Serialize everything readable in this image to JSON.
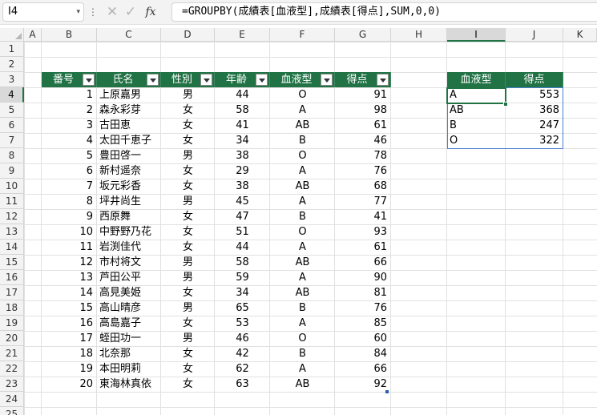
{
  "formula_bar": {
    "name_box": "I4",
    "formula": "=GROUPBY(成績表[血液型],成績表[得点],SUM,0,0)",
    "cancel_glyph": "✕",
    "enter_glyph": "✓",
    "fx_label": "fx"
  },
  "columns": [
    "A",
    "B",
    "C",
    "D",
    "E",
    "F",
    "G",
    "H",
    "I",
    "J",
    "K"
  ],
  "rows": [
    "1",
    "2",
    "3",
    "4",
    "5",
    "6",
    "7",
    "8",
    "9",
    "10",
    "11",
    "12",
    "13",
    "14",
    "15",
    "16",
    "17",
    "18",
    "19",
    "20",
    "21",
    "22",
    "23",
    "24",
    "25"
  ],
  "selected_column": "I",
  "selected_row": "4",
  "score_table": {
    "headers": [
      "番号",
      "氏名",
      "性別",
      "年齢",
      "血液型",
      "得点"
    ],
    "rows": [
      [
        "1",
        "上原嘉男",
        "男",
        "44",
        "O",
        "91"
      ],
      [
        "2",
        "森永彩芽",
        "女",
        "58",
        "A",
        "98"
      ],
      [
        "3",
        "古田恵",
        "女",
        "41",
        "AB",
        "61"
      ],
      [
        "4",
        "太田千恵子",
        "女",
        "34",
        "B",
        "46"
      ],
      [
        "5",
        "豊田啓一",
        "男",
        "38",
        "O",
        "78"
      ],
      [
        "6",
        "新村遥奈",
        "女",
        "29",
        "A",
        "76"
      ],
      [
        "7",
        "坂元彩香",
        "女",
        "38",
        "AB",
        "68"
      ],
      [
        "8",
        "坪井尚生",
        "男",
        "45",
        "A",
        "77"
      ],
      [
        "9",
        "西原舞",
        "女",
        "47",
        "B",
        "41"
      ],
      [
        "10",
        "中野野乃花",
        "女",
        "51",
        "O",
        "93"
      ],
      [
        "11",
        "岩渕佳代",
        "女",
        "44",
        "A",
        "61"
      ],
      [
        "12",
        "市村将文",
        "男",
        "58",
        "AB",
        "66"
      ],
      [
        "13",
        "芦田公平",
        "男",
        "59",
        "A",
        "90"
      ],
      [
        "14",
        "高見美姫",
        "女",
        "34",
        "AB",
        "81"
      ],
      [
        "15",
        "高山晴彦",
        "男",
        "65",
        "B",
        "76"
      ],
      [
        "16",
        "高島嘉子",
        "女",
        "53",
        "A",
        "85"
      ],
      [
        "17",
        "蛭田功一",
        "男",
        "46",
        "O",
        "60"
      ],
      [
        "18",
        "北奈那",
        "女",
        "42",
        "B",
        "84"
      ],
      [
        "19",
        "本田明莉",
        "女",
        "62",
        "A",
        "66"
      ],
      [
        "20",
        "東海林真依",
        "女",
        "63",
        "AB",
        "92"
      ]
    ]
  },
  "groupby_result": {
    "headers": [
      "血液型",
      "得点"
    ],
    "rows": [
      [
        "A",
        "553"
      ],
      [
        "AB",
        "368"
      ],
      [
        "B",
        "247"
      ],
      [
        "O",
        "322"
      ]
    ]
  },
  "colors": {
    "table_header": "#217346",
    "selection": "#217346",
    "spill_border": "#4a7fd1"
  }
}
